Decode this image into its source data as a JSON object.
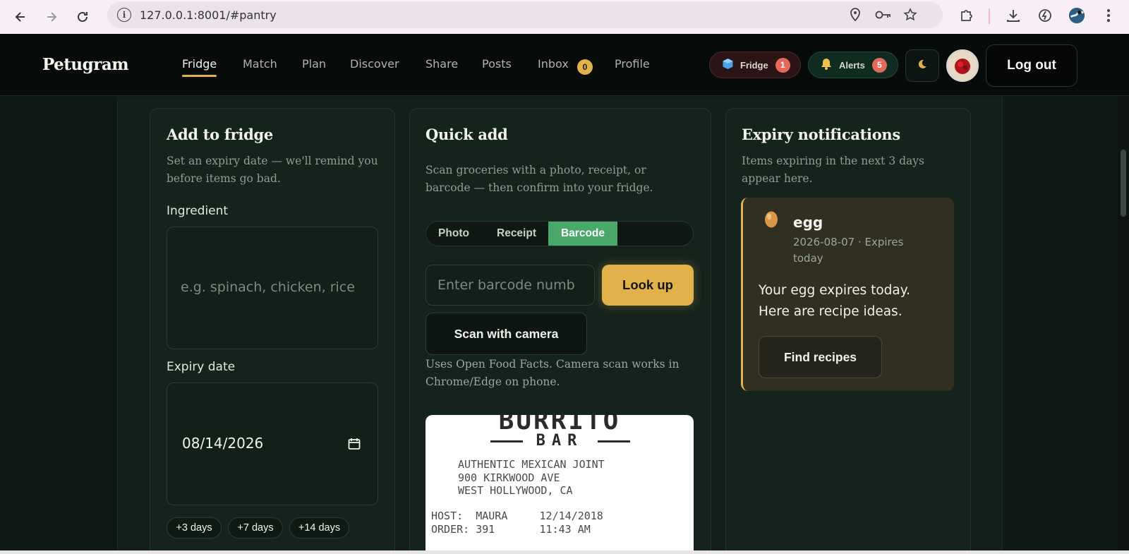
{
  "browser": {
    "url": "127.0.0.1:8001/#pantry"
  },
  "app": {
    "brand": "Petugram",
    "nav": [
      {
        "label": "Fridge",
        "active": true
      },
      {
        "label": "Match"
      },
      {
        "label": "Plan"
      },
      {
        "label": "Discover"
      },
      {
        "label": "Share"
      },
      {
        "label": "Posts"
      },
      {
        "label": "Inbox"
      },
      {
        "label": "Profile"
      }
    ],
    "inbox_count": "0",
    "fridge_pill": {
      "label": "Fridge",
      "count": "1"
    },
    "alerts_pill": {
      "label": "Alerts",
      "count": "5"
    },
    "logout_label": "Log out"
  },
  "add_card": {
    "title": "Add to fridge",
    "subtitle_line1": "Set an expiry date — we'll remind you",
    "subtitle_line2": "before items go bad.",
    "ingredient_label": "Ingredient",
    "ingredient_placeholder": "e.g. spinach, chicken, rice",
    "expiry_label": "Expiry date",
    "expiry_value": "08/14/2026",
    "quick_chips": [
      "+3 days",
      "+7 days",
      "+14 days"
    ]
  },
  "quick_card": {
    "title": "Quick add",
    "subtitle_line1": "Scan groceries with a photo, receipt, or",
    "subtitle_line2": "barcode — then confirm into your fridge.",
    "tabs": [
      {
        "label": "Photo"
      },
      {
        "label": "Receipt"
      },
      {
        "label": "Barcode",
        "active": true
      }
    ],
    "barcode_placeholder": "Enter barcode numb",
    "lookup_label": "Look up",
    "scan_label": "Scan with camera",
    "note_line1": "Uses Open Food Facts. Camera scan works in",
    "note_line2": "Chrome/Edge on phone.",
    "receipt": {
      "title": "BURRITO",
      "subtitle": "BAR",
      "lines": [
        "AUTHENTIC MEXICAN JOINT",
        "900 KIRKWOOD AVE",
        "WEST HOLLYWOOD, CA",
        "HOST:  MAURA     12/14/2018",
        "ORDER: 391       11:43 AM"
      ]
    }
  },
  "expiry_card": {
    "title": "Expiry notifications",
    "subtitle_line1": "Items expiring in the next 3 days",
    "subtitle_line2": "appear here.",
    "notification": {
      "item": "egg",
      "meta_line1": "2026-08-07 · Expires",
      "meta_line2": "today",
      "message_line1": "Your egg expires today.",
      "message_line2": "Here are recipe ideas.",
      "action_label": "Find recipes"
    }
  },
  "colors": {
    "accent": "#e2b24a",
    "active_tab": "#4aa86a",
    "badge": "#e36a5b",
    "background": "#0f1a15"
  }
}
